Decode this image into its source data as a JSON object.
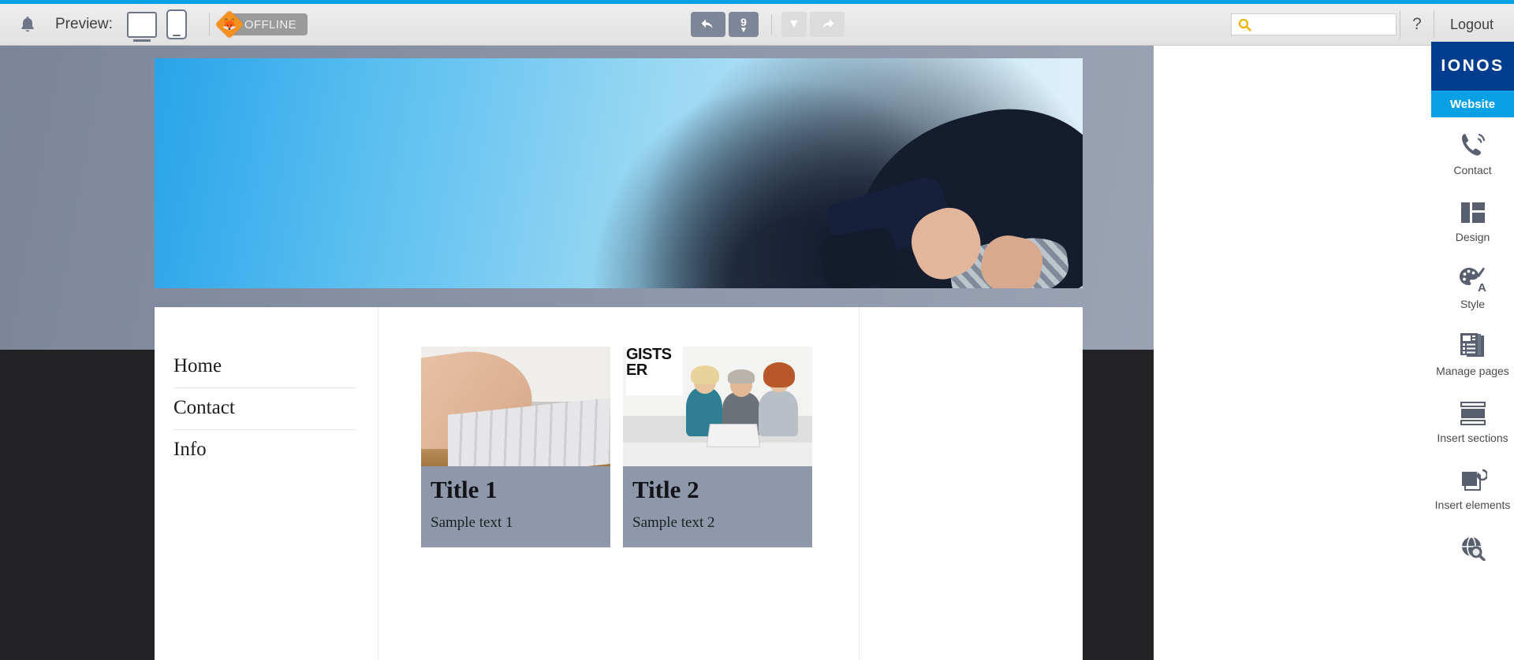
{
  "toolbar": {
    "bell_icon": "bell-icon",
    "preview_label": "Preview:",
    "desktop_icon": "desktop-monitor-icon",
    "mobile_icon": "mobile-phone-icon",
    "status_badge": "OFFLINE",
    "undo_icon": "undo-arrow-icon",
    "undo_count": "9",
    "undo_count_caret": "▼",
    "redo_dropdown_caret": "▼",
    "redo_icon": "redo-arrow-icon",
    "search_icon": "search-magnifier-icon",
    "search_value": "",
    "search_placeholder": "",
    "help_label": "?",
    "logout_label": "Logout"
  },
  "sidebar": {
    "brand": "IONOS",
    "active_tab": "Website",
    "items": [
      {
        "label": "Contact",
        "icon": "phone-call-icon"
      },
      {
        "label": "Design",
        "icon": "layout-grid-icon"
      },
      {
        "label": "Style",
        "icon": "palette-brush-icon"
      },
      {
        "label": "Manage pages",
        "icon": "page-stack-icon"
      },
      {
        "label": "Insert sections",
        "icon": "section-bars-icon"
      },
      {
        "label": "Insert elements",
        "icon": "element-layers-icon"
      },
      {
        "label": "",
        "icon": "globe-search-icon"
      }
    ]
  },
  "page": {
    "hero_image_alt": "photographer-with-camera-against-blue-sky",
    "nav": [
      {
        "label": "Home"
      },
      {
        "label": "Contact"
      },
      {
        "label": "Info"
      }
    ],
    "cards": [
      {
        "title": "Title 1",
        "subtitle": "Sample text 1",
        "image_alt": "hands-typing-on-laptop-keyboard",
        "poster_text": ""
      },
      {
        "title": "Title 2",
        "subtitle": "Sample text 2",
        "image_alt": "three-colleagues-around-laptop-in-office",
        "poster_text": "GISTS ER"
      }
    ]
  },
  "colors": {
    "accent_blue": "#0aa0e6",
    "brand_navy": "#003d8f",
    "toolbar_button": "#7d8799",
    "offline_orange": "#f5911e",
    "search_icon_gold": "#f0b400"
  }
}
